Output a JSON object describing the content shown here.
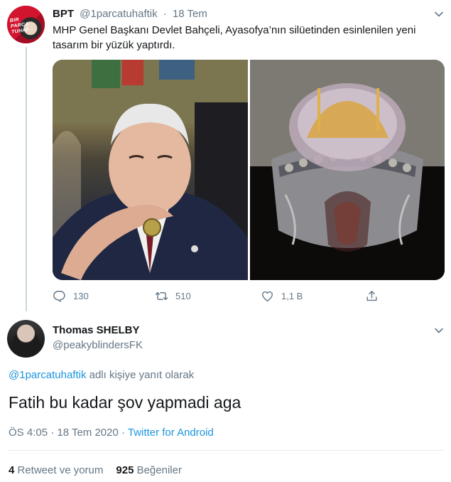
{
  "parent_tweet": {
    "display_name": "BPT",
    "handle": "@1parcatuhaftik",
    "separator": "·",
    "date": "18 Tem",
    "text": "MHP Genel Başkanı Devlet Bahçeli, Ayasofya’nın silüetinden esinlenilen yeni tasarım bir yüzük yaptırdı.",
    "avatar_logo": "BIR PARCA TUHAF",
    "actions": {
      "reply_count": "130",
      "retweet_count": "510",
      "like_count": "1,1 B"
    }
  },
  "reply_tweet": {
    "display_name": "Thomas SHELBY",
    "handle": "@peakyblindersFK",
    "replying_to_mention": "@1parcatuhaftik",
    "replying_to_suffix": " adlı kişiye yanıt olarak",
    "text": "Fatih bu kadar şov yapmadi aga",
    "time": "ÖS 4:05 · 18 Tem 2020 · ",
    "source": "Twitter for Android",
    "retweets_count": "4",
    "retweets_label": " Retweet ve yorum",
    "likes_count": "925",
    "likes_label": " Beğeniler"
  },
  "colors": {
    "text": "#14171a",
    "muted": "#657786",
    "link": "#1b95e0",
    "divider": "#e6ecf0"
  },
  "icons": [
    "caret-down-icon",
    "reply-icon",
    "retweet-icon",
    "like-icon",
    "share-icon"
  ]
}
